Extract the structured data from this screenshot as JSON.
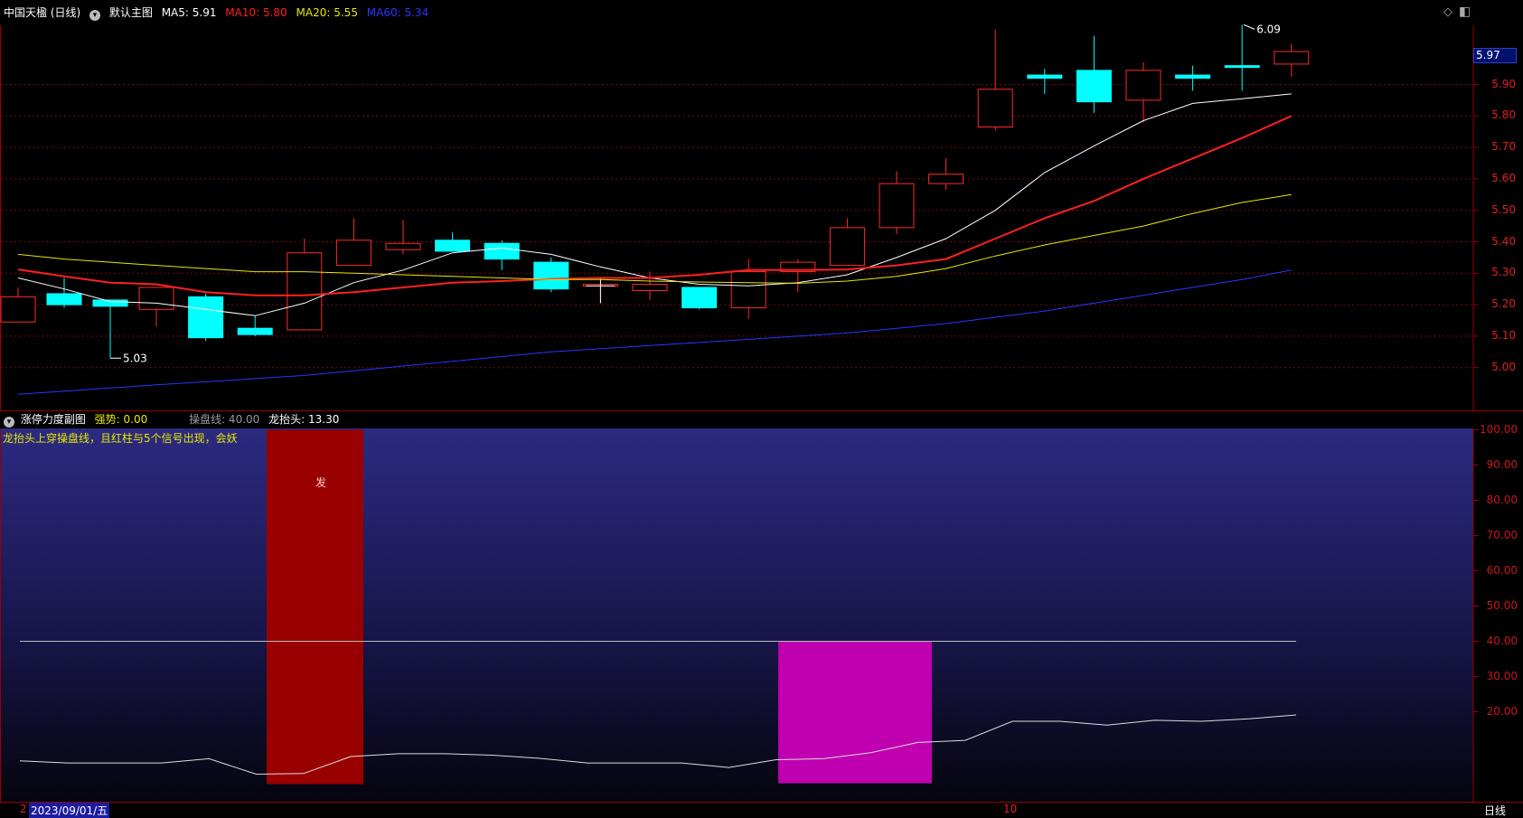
{
  "main": {
    "stock_title": "中国天楹 (日线)",
    "template_label": "默认主图",
    "ma": [
      {
        "label": "MA5: 5.91",
        "color": "#ffffff"
      },
      {
        "label": "MA10: 5.80",
        "color": "#ff2020"
      },
      {
        "label": "MA20: 5.55",
        "color": "#e8e800"
      },
      {
        "label": "MA60: 5.34",
        "color": "#2a35ff"
      }
    ],
    "price_levels": [
      "5.90",
      "5.80",
      "5.70",
      "5.60",
      "5.50",
      "5.40",
      "5.30",
      "5.20",
      "5.10",
      "5.00"
    ],
    "current_price": "5.97",
    "high_marker": "6.09",
    "low_marker": "5.03",
    "colors": {
      "up": "#ff2a2a",
      "down": "#00ffff",
      "grid": "#7a0a0a",
      "axis": "#9a0000"
    }
  },
  "sub": {
    "title": "涨停力度副图",
    "strength_label": "强势: 0.00",
    "ops_label": "操盘线: 40.00",
    "dragon_label": "龙抬头: 13.30",
    "note": "龙抬头上穿操盘线，且红柱与5个信号出现，会妖",
    "signal_char": "发",
    "levels": [
      "100.00",
      "90.00",
      "80.00",
      "70.00",
      "60.00",
      "50.00",
      "40.00",
      "30.00",
      "20.00"
    ],
    "ops_value": 40,
    "dragon_series": [
      6.1,
      5.5,
      5.5,
      5.5,
      6.7,
      2.3,
      2.5,
      7.3,
      8.1,
      8.1,
      7.7,
      6.8,
      5.5,
      5.5,
      5.5,
      4.2,
      6.4,
      6.7,
      8.4,
      11.3,
      11.9,
      17.3,
      17.3,
      16.2,
      17.6,
      17.3,
      18.0,
      19.1
    ],
    "red_bar_range": [
      6,
      7
    ],
    "magenta_bar_range": [
      17,
      19
    ],
    "colors": {
      "red_bar": "#990000",
      "magenta_bar": "#c000b0",
      "ops_line": "#bbbbbb",
      "dragon_line": "#dddddd"
    }
  },
  "x_axis": {
    "cursor_date": "2023/09/01/五",
    "cursor_prefix": "2",
    "month_label": "10",
    "period_label": "日线"
  },
  "toolbar": {
    "diamond_icon": "◇",
    "window_icon": "◧"
  }
}
